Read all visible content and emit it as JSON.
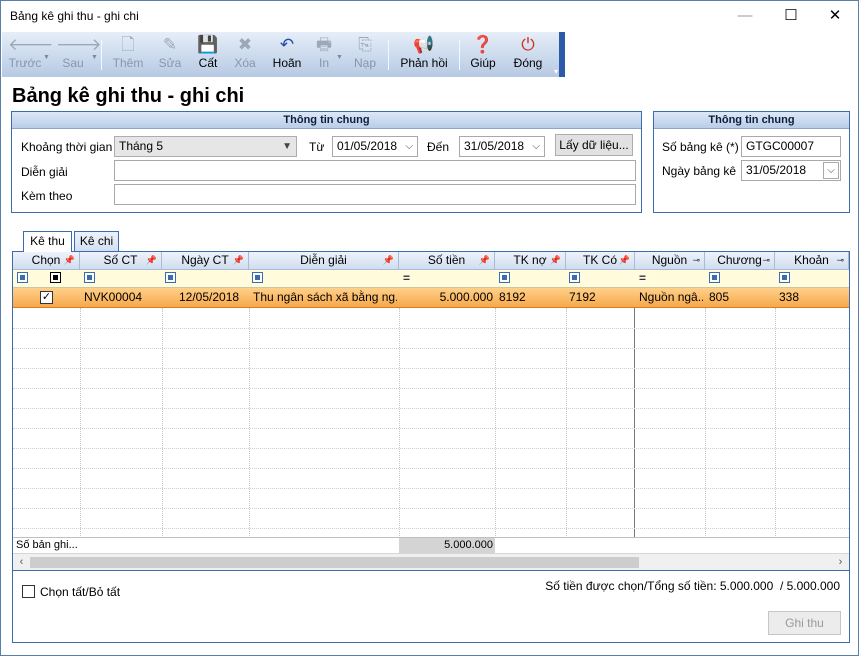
{
  "window": {
    "title": "Bảng kê ghi thu - ghi chi",
    "min": "—",
    "max": "☐",
    "close": "✕"
  },
  "toolbar": {
    "prev": "Trước",
    "next": "Sau",
    "add": "Thêm",
    "edit": "Sửa",
    "save": "Cất",
    "delete": "Xóa",
    "undo": "Hoãn",
    "print": "In",
    "load": "Nạp",
    "feedback": "Phản hồi",
    "help": "Giúp",
    "close": "Đóng"
  },
  "page_title": "Bảng kê ghi thu - ghi chi",
  "general": {
    "header": "Thông tin chung",
    "period_label": "Khoảng thời gian",
    "period_value": "Tháng 5",
    "from_label": "Từ",
    "from_value": "01/05/2018",
    "to_label": "Đến",
    "to_value": "31/05/2018",
    "fetch_button": "Lấy dữ liệu...",
    "description_label": "Diễn giải",
    "description_value": "",
    "attach_label": "Kèm theo",
    "attach_value": ""
  },
  "doc_info": {
    "header": "Thông tin chung",
    "number_label": "Số bảng kê (*)",
    "number_value": "GTGC00007",
    "date_label": "Ngày bảng kê",
    "date_value": "31/05/2018"
  },
  "tabs": [
    {
      "label": "Kê thu"
    },
    {
      "label": "Kê chi"
    }
  ],
  "grid": {
    "columns": [
      "Chọn",
      "Số CT",
      "Ngày CT",
      "Diễn giải",
      "Số tiền",
      "TK nợ",
      "TK Có",
      "Nguồn",
      "Chương",
      "Khoản"
    ],
    "rows": [
      {
        "selected": "✓",
        "doc_no": "NVK00004",
        "doc_date": "12/05/2018",
        "description": "Thu ngân sách xã bằng ng...",
        "amount": "5.000.000",
        "debit": "8192",
        "credit": "7192",
        "source": "Nguồn ngâ...",
        "chapter": "805",
        "item": "338"
      }
    ],
    "summary_label": "Số bản ghi...",
    "summary_amount": "5.000.000"
  },
  "footer": {
    "select_all_label": "Chọn tất/Bỏ tất",
    "totals_text": "Số tiền được chọn/Tổng số tiền: 5.000.000  / 5.000.000",
    "submit_button": "Ghi thu"
  },
  "colors": {
    "accent": "#3c6bb0",
    "selected_row": "#f6a94a",
    "filter_row": "#fffbdc"
  }
}
